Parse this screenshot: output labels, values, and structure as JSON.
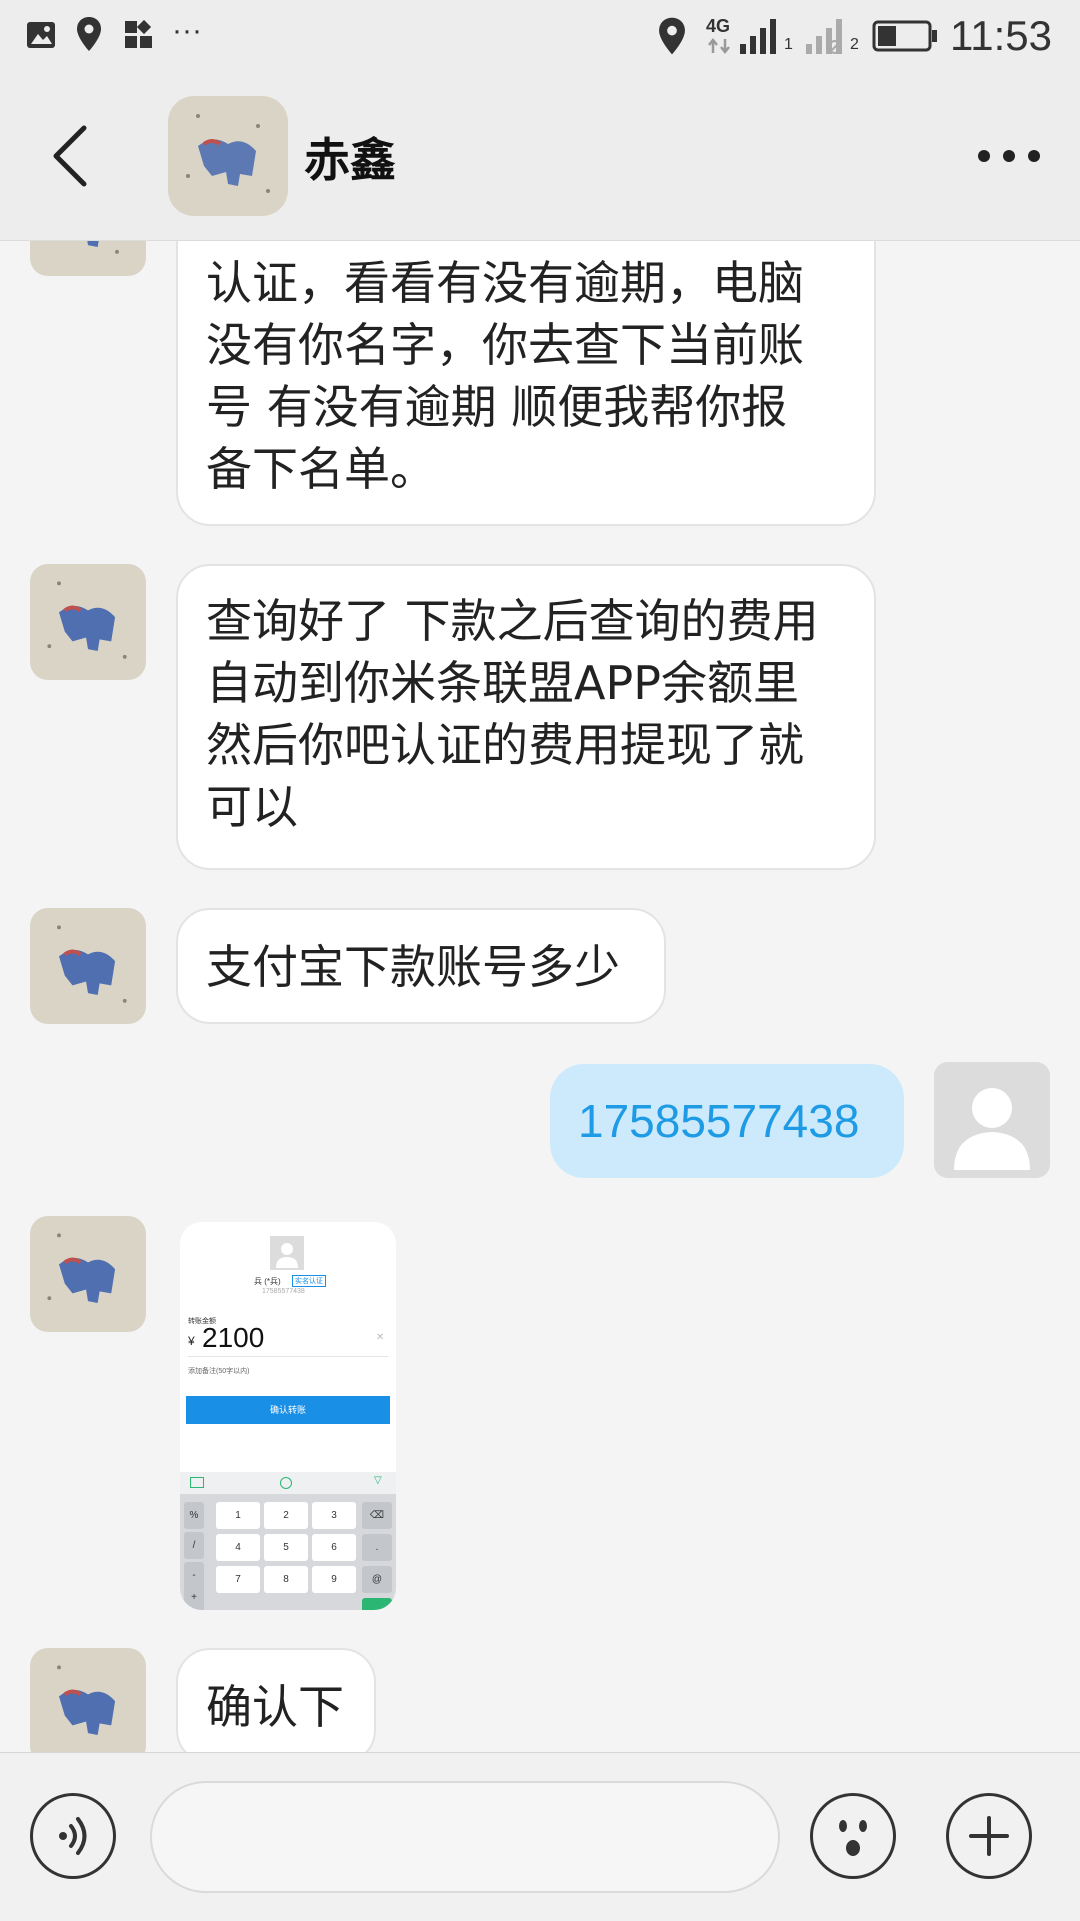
{
  "status_bar": {
    "network": "4G",
    "sim1": "1",
    "sim2": "2",
    "time": "11:53",
    "more": "···"
  },
  "header": {
    "title": "赤鑫",
    "back_icon": "chevron-left-icon",
    "more_icon": "more-dots-icon"
  },
  "messages": [
    {
      "side": "left",
      "lines": [
        "认证，看看有没有逾期，电脑",
        "没有你名字，你去查下当前账",
        "号 有没有逾期 顺便我帮你报",
        "备下名单。"
      ]
    },
    {
      "side": "left",
      "lines": [
        "查询好了 下款之后查询的费用",
        "自动到你米条联盟APP余额里",
        "然后你吧认证的费用提现了就",
        "可以"
      ]
    },
    {
      "side": "left",
      "lines": [
        "支付宝下款账号多少"
      ]
    },
    {
      "side": "right",
      "lines": [
        "17585577438"
      ]
    },
    {
      "side": "left",
      "type": "image",
      "screenshot": {
        "name": "兵 (*兵)",
        "tag": "实名认证",
        "phone": "175855774​38",
        "amount_label": "转账金额",
        "currency": "¥",
        "amount": "2100",
        "note": "添加备注(50字以内)",
        "confirm": "确认转账",
        "keys": [
          "1",
          "2",
          "3",
          "4",
          "5",
          "6",
          "7",
          "8",
          "9"
        ],
        "side_keys": [
          "%",
          "/",
          "-",
          "+"
        ],
        "right_keys": [
          "⌫",
          ".",
          "@"
        ]
      }
    },
    {
      "side": "left",
      "lines": [
        "确认下"
      ]
    }
  ],
  "input_bar": {
    "voice_icon": "voice-icon",
    "emoji_icon": "emoji-icon",
    "plus_icon": "plus-icon"
  },
  "colors": {
    "background": "#f4f4f4",
    "my_bubble": "#cdeafc",
    "my_text": "#1e9be4",
    "confirm_button": "#1a8fe6"
  }
}
